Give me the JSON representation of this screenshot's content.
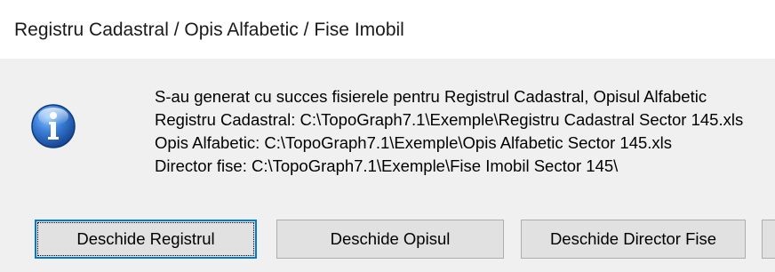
{
  "window": {
    "title": "Registru Cadastral / Opis Alfabetic / Fise Imobil"
  },
  "icon": "information-icon",
  "message": {
    "lines": [
      "S-au generat cu succes fisierele pentru Registrul Cadastral, Opisul Alfabetic",
      "Registru Cadastral: C:\\TopoGraph7.1\\Exemple\\Registru Cadastral Sector 145.xls",
      "Opis Alfabetic: C:\\TopoGraph7.1\\Exemple\\Opis Alfabetic Sector 145.xls",
      "Director fise: C:\\TopoGraph7.1\\Exemple\\Fise Imobil Sector 145\\"
    ]
  },
  "buttons": {
    "open_registry": "Deschide Registrul",
    "open_index": "Deschide Opisul",
    "open_folder": "Deschide Director Fise",
    "partial": ""
  },
  "colors": {
    "title_bg": "#ffffff",
    "content_bg": "#f0f0f0",
    "button_bg": "#e1e1e1",
    "button_border": "#adadad",
    "default_button_border": "#0078d7",
    "icon_blue": "#1f5fb8"
  }
}
